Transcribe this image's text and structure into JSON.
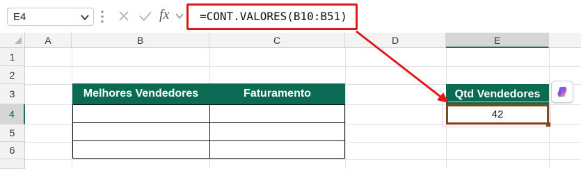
{
  "formula_bar": {
    "name_box": "E4",
    "formula": "=CONT.VALORES(B10:B51)",
    "fx_label": "fx"
  },
  "columns": [
    "A",
    "B",
    "C",
    "D",
    "E"
  ],
  "rows": [
    "1",
    "2",
    "3",
    "4",
    "5",
    "6"
  ],
  "table": {
    "headers": [
      "Melhores Vendedores",
      "Faturamento"
    ],
    "rows": [
      [
        "",
        ""
      ],
      [
        "",
        ""
      ],
      [
        "",
        ""
      ]
    ]
  },
  "result": {
    "header": "Qtd Vendedores",
    "value": "42"
  },
  "colors": {
    "header_green": "#0b6b52",
    "highlight_red": "#e01818",
    "selection_brown": "#7b4a1e",
    "excel_green": "#217346"
  },
  "icons": [
    "chevron-down-icon",
    "cancel-icon",
    "enter-icon",
    "fx-icon",
    "copilot-icon",
    "arrow-annotation"
  ]
}
